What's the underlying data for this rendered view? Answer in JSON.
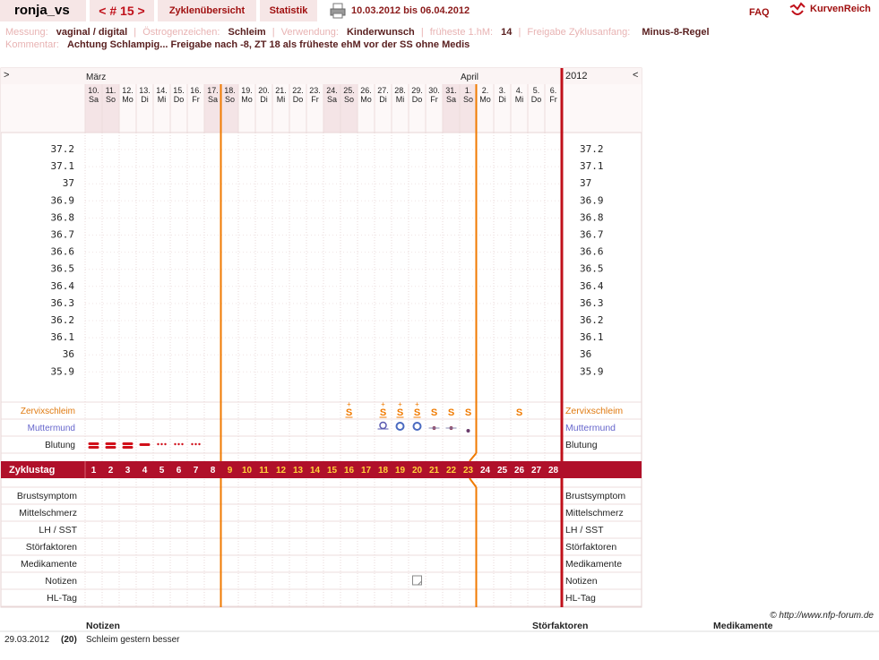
{
  "topbar": {
    "user": "ronja_vs",
    "cycle_nav": "< # 15 >",
    "overview": "Zyklenübersicht",
    "stats": "Statistik",
    "date_range": "10.03.2012 bis 06.04.2012",
    "faq": "FAQ",
    "logo": "KurvenReich"
  },
  "info": {
    "messung_label": "Messung:",
    "messung": "vaginal / digital",
    "oestrogen_label": "Östrogenzeichen:",
    "oestrogen": "Schleim",
    "verwendung_label": "Verwendung:",
    "verwendung": "Kinderwunsch",
    "hm_label": "früheste 1.hM:",
    "hm": "14",
    "freigabe_label": "Freigabe Zyklusanfang:",
    "freigabe": "Minus-8-Regel",
    "kommentar_label": "Kommentar:",
    "kommentar": "Achtung Schlampig... Freigabe nach -8, ZT 18 als früheste ehM vor der SS ohne Medis"
  },
  "chart": {
    "nav_left": ">",
    "nav_right": "<",
    "month_maerz": "März",
    "month_april": "April",
    "year": "2012",
    "days": [
      "10.",
      "11.",
      "12.",
      "13.",
      "14.",
      "15.",
      "16.",
      "17.",
      "18.",
      "19.",
      "20.",
      "21.",
      "22.",
      "23.",
      "24.",
      "25.",
      "26.",
      "27.",
      "28.",
      "29.",
      "30.",
      "31.",
      "1.",
      "2.",
      "3.",
      "4.",
      "5.",
      "6."
    ],
    "weekdays": [
      "Sa",
      "So",
      "Mo",
      "Di",
      "Mi",
      "Do",
      "Fr",
      "Sa",
      "So",
      "Mo",
      "Di",
      "Mi",
      "Do",
      "Fr",
      "Sa",
      "So",
      "Mo",
      "Di",
      "Mi",
      "Do",
      "Fr",
      "Sa",
      "So",
      "Mo",
      "Di",
      "Mi",
      "Do",
      "Fr"
    ],
    "temps": [
      "37.2",
      "37.1",
      "37",
      "36.9",
      "36.8",
      "36.7",
      "36.6",
      "36.5",
      "36.4",
      "36.3",
      "36.2",
      "36.1",
      "36",
      "35.9"
    ],
    "row_zervix": "Zervixschleim",
    "row_muttermund": "Muttermund",
    "row_blutung": "Blutung",
    "zyklustag_label": "Zyklustag",
    "cycle_days": [
      "1",
      "2",
      "3",
      "4",
      "5",
      "6",
      "7",
      "8",
      "9",
      "10",
      "11",
      "12",
      "13",
      "14",
      "15",
      "16",
      "17",
      "18",
      "19",
      "20",
      "21",
      "22",
      "23",
      "24",
      "25",
      "26",
      "27",
      "28"
    ],
    "lower_rows": [
      "Brustsymptom",
      "Mittelschmerz",
      "LH / SST",
      "Störfaktoren",
      "Medikamente",
      "Notizen",
      "HL-Tag"
    ],
    "zervix_marks": [
      {
        "day": 16,
        "sym": "S",
        "plus": true
      },
      {
        "day": 18,
        "sym": "S",
        "plus": true
      },
      {
        "day": 19,
        "sym": "S",
        "plus": true
      },
      {
        "day": 20,
        "sym": "S",
        "plus": true
      },
      {
        "day": 21,
        "sym": "S",
        "plus": false
      },
      {
        "day": 22,
        "sym": "S",
        "plus": false
      },
      {
        "day": 23,
        "sym": "S",
        "plus": false
      },
      {
        "day": 26,
        "sym": "S",
        "plus": false
      }
    ],
    "blutung": [
      {
        "day": 1,
        "level": "stark"
      },
      {
        "day": 2,
        "level": "stark"
      },
      {
        "day": 3,
        "level": "stark"
      },
      {
        "day": 4,
        "level": "mittel"
      },
      {
        "day": 5,
        "level": "schmier"
      },
      {
        "day": 6,
        "level": "schmier"
      },
      {
        "day": 7,
        "level": "schmier"
      }
    ],
    "muttermund": [
      {
        "day": 18,
        "type": "open-small"
      },
      {
        "day": 19,
        "type": "open"
      },
      {
        "day": 20,
        "type": "open"
      },
      {
        "day": 21,
        "type": "closed-small"
      },
      {
        "day": 22,
        "type": "closed-small"
      },
      {
        "day": 23,
        "type": "closed"
      }
    ],
    "note_day": 20,
    "weekend_days": [
      1,
      2,
      8,
      9,
      15,
      16,
      22,
      23
    ],
    "colors": {
      "orange": "#f07a00",
      "red": "#c0101a",
      "bar": "#b0102a",
      "grid": "#eee0e0",
      "weekend": "#f4e4e6"
    }
  },
  "copyright": "© http://www.nfp-forum.de",
  "notes_table": {
    "headers": {
      "notizen": "Notizen",
      "stoerfaktoren": "Störfaktoren",
      "medikamente": "Medikamente"
    },
    "rows": [
      {
        "date": "29.03.2012",
        "cd": "(20)",
        "text": "Schleim gestern besser"
      }
    ]
  }
}
